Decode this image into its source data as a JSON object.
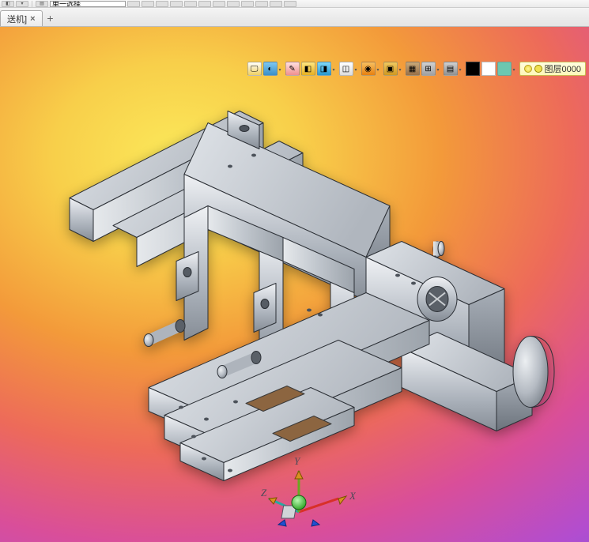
{
  "top_toolbar": {
    "selection_mode": "单一选择"
  },
  "tabs": {
    "active_tab_label": "送机]",
    "close_label": "×",
    "add_label": "+"
  },
  "layer": {
    "label": "图层0000"
  },
  "axes": {
    "x_label": "X",
    "y_label": "Y",
    "z_label": "Z"
  }
}
